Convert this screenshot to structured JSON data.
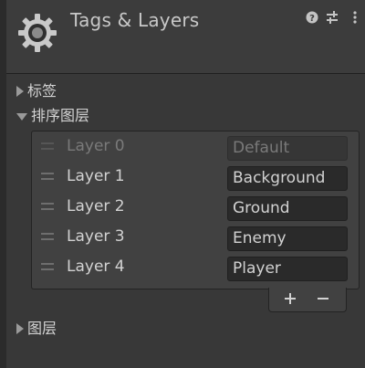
{
  "header": {
    "title": "Tags & Layers",
    "icons": [
      "gear-icon",
      "help-icon",
      "preset-icon",
      "menu-icon"
    ]
  },
  "sections": {
    "tags_label": "标签",
    "sorting_layers_label": "排序图层",
    "layers_label": "图层"
  },
  "sorting_layers": [
    {
      "label": "Layer 0",
      "value": "Default"
    },
    {
      "label": "Layer 1",
      "value": "Background"
    },
    {
      "label": "Layer 2",
      "value": "Ground"
    },
    {
      "label": "Layer 3",
      "value": "Enemy"
    },
    {
      "label": "Layer 4",
      "value": "Player"
    }
  ],
  "colors": {
    "background": "#383838",
    "field": "#2a2a2a",
    "text": "#d2d2d2"
  }
}
